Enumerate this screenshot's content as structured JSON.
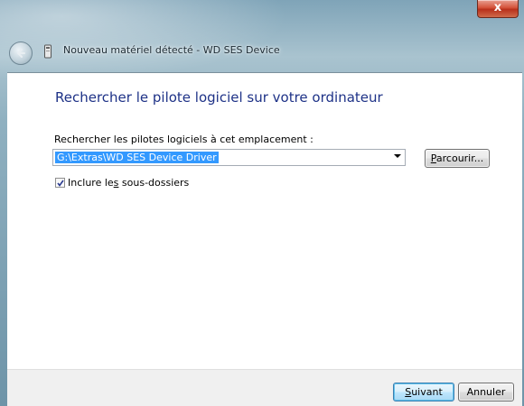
{
  "window": {
    "title": "Nouveau matériel détecté - WD SES Device",
    "close_glyph": "x"
  },
  "content": {
    "heading": "Rechercher le pilote logiciel sur votre ordinateur",
    "path_label": "Rechercher les pilotes logiciels à cet emplacement :",
    "path_value": "G:\\Extras\\WD SES Device Driver",
    "browse_button": {
      "accel": "P",
      "rest": "arcourir..."
    },
    "include_subfolders": {
      "pre": "Inclure le",
      "accel": "s",
      "post": " sous-dossiers",
      "checked": true
    }
  },
  "footer": {
    "next_button": {
      "accel": "S",
      "rest": "uivant"
    },
    "cancel_button": "Annuler"
  },
  "icons": {
    "back": "back-arrow-icon",
    "device": "device-icon",
    "close": "close-icon",
    "dropdown": "dropdown-arrow-icon",
    "check": "checkmark-icon"
  },
  "colors": {
    "heading": "#1e3287",
    "selection": "#3399ff",
    "close_button": "#c8452c"
  }
}
